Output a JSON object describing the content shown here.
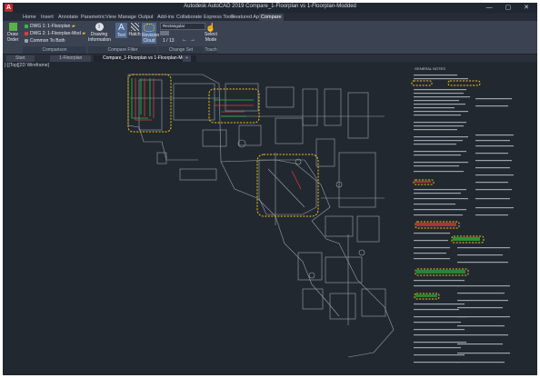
{
  "window": {
    "title": "Autodesk AutoCAD 2019    Compare_1-Floorplan vs 1-Floorplan-Modded",
    "logo": "A",
    "controls": "— ▢ ✕"
  },
  "ribbon_tabs": [
    "Home",
    "Insert",
    "Annotate",
    "Parametric",
    "View",
    "Manage",
    "Output",
    "Add-ins",
    "Collaborate",
    "Express Tools",
    "Featured Apps",
    "Compare"
  ],
  "ribbon": {
    "draw_order_label": "Draw Order",
    "dwg1_label": "DWG 1:  1-Floorplan",
    "dwg2_label": "DWG 2:  1-Floorplan-Mod",
    "common_label": "Common To Both",
    "drawing_info_label": "Drawing Information",
    "text_label": "Text",
    "hatch_label": "Hatch",
    "revision_cloud_label": "Revision Cloud",
    "shape_value": "Rectangular",
    "page_value": "1 / 13",
    "select_mode_label": "Select Mode",
    "panels": {
      "comparison": "Comparison",
      "compare_filter": "Compare Filter",
      "change_set": "Change Set",
      "touch": "Touch"
    }
  },
  "doc_tabs": [
    "Start",
    "1-Floorplan",
    "Compare_1-Floorplan vs 1-Floorplan-Mod"
  ],
  "viewport_label": "[-][Top][2D Wireframe]",
  "colors": {
    "dwg1": "#2fbf3f",
    "dwg2": "#e23a3a",
    "common": "#9aa3ad",
    "cloud": "#f2c21b",
    "accent": "#1b74c9"
  },
  "notes_legend": "GENERAL NOTES"
}
